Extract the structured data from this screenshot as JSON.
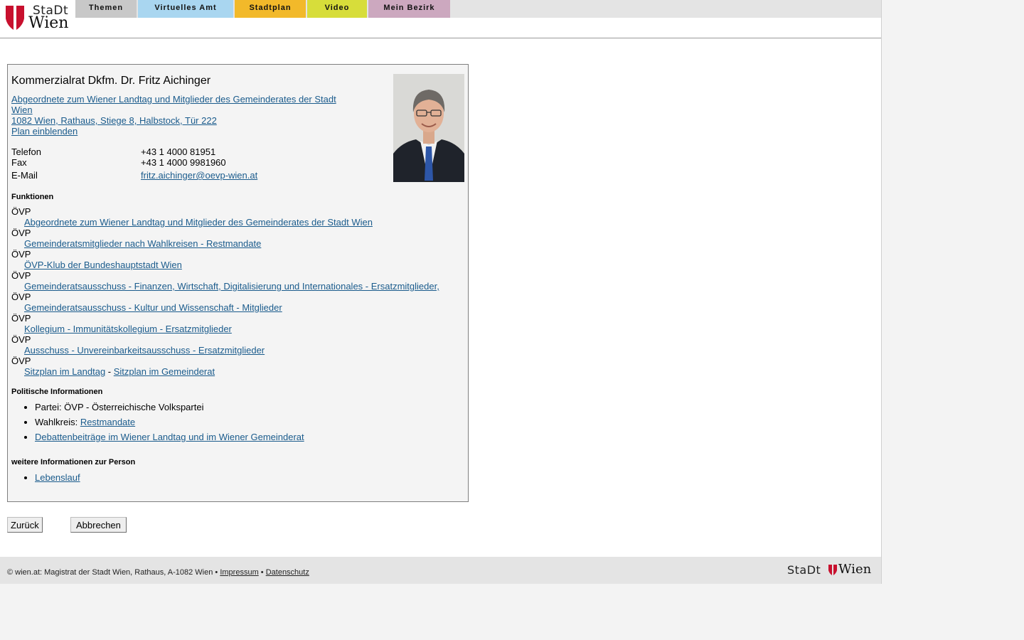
{
  "colors": {
    "brand_red": "#c8102e",
    "tab_themen": "#c8c8c8",
    "tab_amt": "#a9d6f0",
    "tab_stadtplan": "#f2b92a",
    "tab_video": "#d7dd3a",
    "tab_bezirk": "#cca8bf",
    "link": "#1a5b8c"
  },
  "header": {
    "logo_top": "StaDt",
    "logo_bottom": "Wien",
    "nav": [
      "Themen",
      "Virtuelles Amt",
      "Stadtplan",
      "Video",
      "Mein Bezirk"
    ]
  },
  "person": {
    "name": "Kommerzialrat Dkfm. Dr. Fritz Aichinger",
    "role_line1": "Abgeordnete zum Wiener Landtag und Mitglieder des Gemeinderates der Stadt",
    "role_line2": "Wien ",
    "address": "1082 Wien, Rathaus, Stiege 8, Halbstock, Tür 222",
    "plan_link": "Plan einblenden",
    "contact": {
      "phone_label": "Telefon",
      "phone": "+43 1 4000 81951",
      "fax_label": "Fax",
      "fax": "+43 1 4000 9981960",
      "email_label": "E-Mail",
      "email": "fritz.aichinger@oevp-wien.at"
    }
  },
  "functions": {
    "title": "Funktionen",
    "items": [
      {
        "party": "ÖVP",
        "link": "Abgeordnete zum Wiener Landtag und Mitglieder des Gemeinderates der Stadt Wien"
      },
      {
        "party": "ÖVP",
        "link": "Gemeinderatsmitglieder nach Wahlkreisen - Restmandate"
      },
      {
        "party": "ÖVP",
        "link": "ÖVP-Klub der Bundeshauptstadt Wien"
      },
      {
        "party": "ÖVP",
        "link": "Gemeinderatsausschuss - Finanzen, Wirtschaft, Digitalisierung und Internationales - Ersatzmitglieder, "
      },
      {
        "party": "ÖVP",
        "link": "Gemeinderatsausschuss - Kultur und Wissenschaft - Mitglieder"
      },
      {
        "party": "ÖVP",
        "link": "Kollegium - Immunitätskollegium - Ersatzmitglieder"
      },
      {
        "party": "ÖVP",
        "link": "Ausschuss - Unvereinbarkeitsausschuss - Ersatzmitglieder"
      }
    ],
    "seat_party": "ÖVP",
    "seat_landtag": "Sitzplan im Landtag",
    "seat_sep": " - ",
    "seat_gemeinderat": "Sitzplan im Gemeinderat"
  },
  "political": {
    "title": "Politische Informationen",
    "party_label": "Partei: ÖVP - Österreichische Volkspartei",
    "district_label": "Wahlkreis: ",
    "district_link": "Restmandate",
    "debates_link": "Debattenbeiträge im Wiener Landtag und im Wiener Gemeinderat"
  },
  "more": {
    "title": "weitere Informationen zur Person",
    "cv_link": "Lebenslauf"
  },
  "buttons": {
    "back": "Zurück",
    "cancel": "Abbrechen"
  },
  "footer": {
    "copyright": "© wien.at: Magistrat der Stadt Wien, Rathaus, A-1082 Wien • ",
    "impressum": "Impressum",
    "sep": " • ",
    "datenschutz": "Datenschutz",
    "logo_left": "StaDt",
    "logo_right": "Wien"
  }
}
